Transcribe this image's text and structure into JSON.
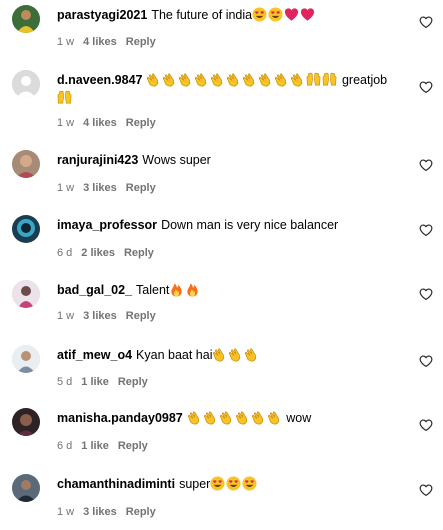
{
  "comments": [
    {
      "user": "parastyagi2021",
      "text": "The future of india",
      "emojis": [
        "smile-heart-eyes-emoji",
        "smile-heart-eyes-emoji",
        "red-heart-emoji",
        "red-heart-emoji"
      ],
      "time": "1 w",
      "likes": "4 likes",
      "reply": "Reply",
      "avatar": "avatar-green-yellow"
    },
    {
      "user": "d.naveen.9847",
      "text": "",
      "emojis": [
        "clap-emoji",
        "clap-emoji",
        "clap-emoji",
        "clap-emoji",
        "clap-emoji",
        "clap-emoji",
        "clap-emoji",
        "clap-emoji",
        "clap-emoji",
        "clap-emoji",
        "raised-hands-emoji",
        "raised-hands-emoji"
      ],
      "text_after": "greatjob",
      "emojis2": [
        "raised-hands-emoji"
      ],
      "time": "1 w",
      "likes": "4 likes",
      "reply": "Reply",
      "avatar": "avatar-default"
    },
    {
      "user": "ranjurajini423",
      "text": "Wows super",
      "emojis": [],
      "time": "1 w",
      "likes": "3 likes",
      "reply": "Reply",
      "avatar": "avatar-photo-woman"
    },
    {
      "user": "imaya_professor",
      "text": "Down man is very nice balancer",
      "emojis": [],
      "time": "6 d",
      "likes": "2 likes",
      "reply": "Reply",
      "avatar": "avatar-photo-teal"
    },
    {
      "user": "bad_gal_02_",
      "text": "Talent",
      "emojis": [
        "fire-emoji",
        "fire-emoji"
      ],
      "time": "1 w",
      "likes": "3 likes",
      "reply": "Reply",
      "avatar": "avatar-photo-pink"
    },
    {
      "user": "atif_mew_o4",
      "text": "Kyan baat hai",
      "emojis": [
        "clap-emoji",
        "clap-emoji",
        "clap-emoji"
      ],
      "time": "5 d",
      "likes": "1 like",
      "reply": "Reply",
      "avatar": "avatar-photo-light"
    },
    {
      "user": "manisha.panday0987",
      "text": "",
      "emojis": [
        "clap-emoji",
        "clap-emoji",
        "clap-emoji",
        "clap-emoji",
        "clap-emoji",
        "clap-emoji"
      ],
      "text_after": "wow",
      "time": "6 d",
      "likes": "1 like",
      "reply": "Reply",
      "avatar": "avatar-photo-dark"
    },
    {
      "user": "chamanthinadiminti",
      "text": "super",
      "emojis": [
        "smile-heart-eyes-emoji",
        "smile-heart-eyes-emoji",
        "smile-heart-eyes-emoji"
      ],
      "time": "1 w",
      "likes": "3 likes",
      "reply": "Reply",
      "avatar": "avatar-photo-man"
    }
  ],
  "colors": {
    "meta": "#737373",
    "heart": "#262626",
    "emoji_yellow": "#f7c325",
    "emoji_red": "#e0245e",
    "fire": "#f5711f"
  }
}
